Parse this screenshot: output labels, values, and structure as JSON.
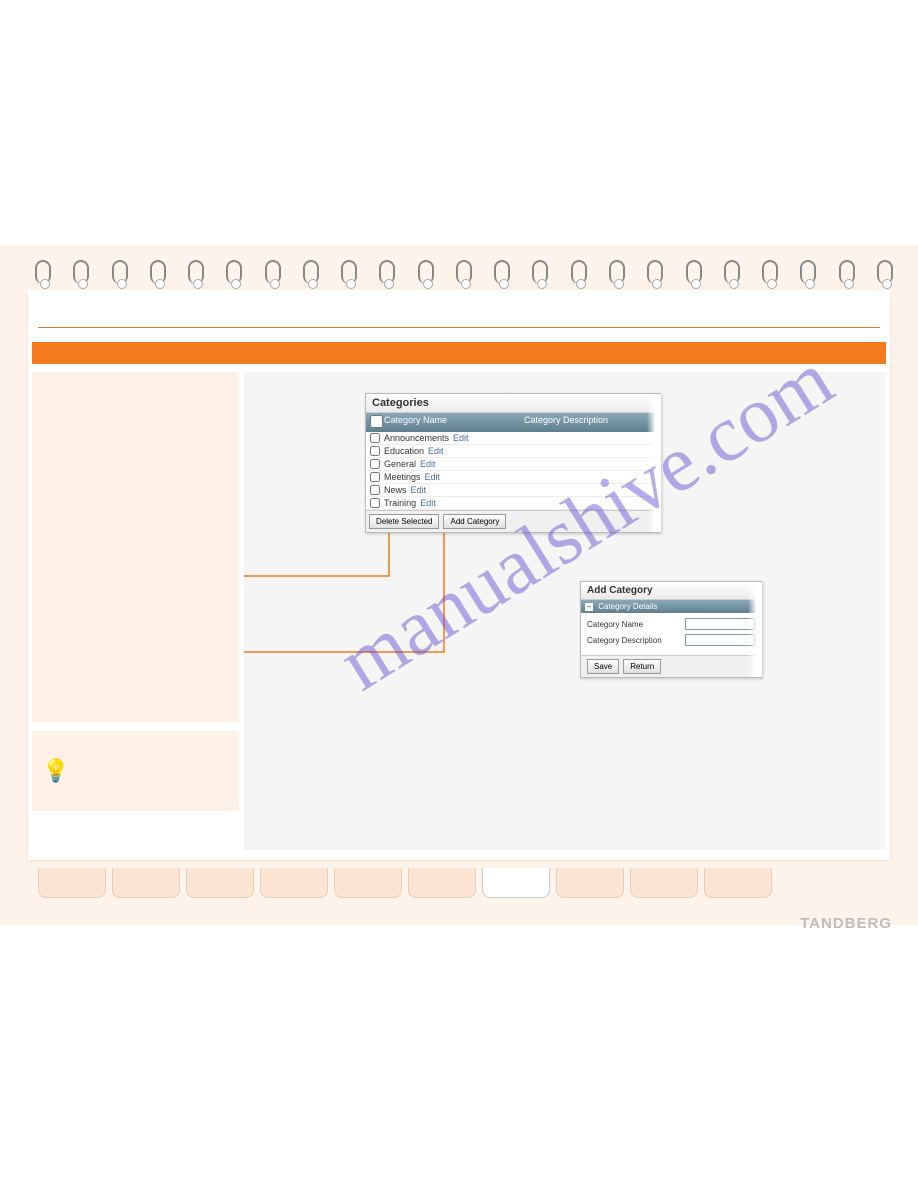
{
  "categories_panel": {
    "title": "Categories",
    "col_name": "Category Name",
    "col_desc": "Category Description",
    "rows": [
      {
        "name": "Announcements",
        "edit": "Edit"
      },
      {
        "name": "Education",
        "edit": "Edit"
      },
      {
        "name": "General",
        "edit": "Edit"
      },
      {
        "name": "Meetings",
        "edit": "Edit"
      },
      {
        "name": "News",
        "edit": "Edit"
      },
      {
        "name": "Training",
        "edit": "Edit"
      }
    ],
    "btn_delete": "Delete Selected",
    "btn_add": "Add Category"
  },
  "add_panel": {
    "title": "Add Category",
    "section": "Category Details",
    "field_name": "Category Name",
    "field_desc": "Category Description",
    "btn_save": "Save",
    "btn_return": "Return"
  },
  "brand": "TANDBERG",
  "watermark": "manualshive.com"
}
